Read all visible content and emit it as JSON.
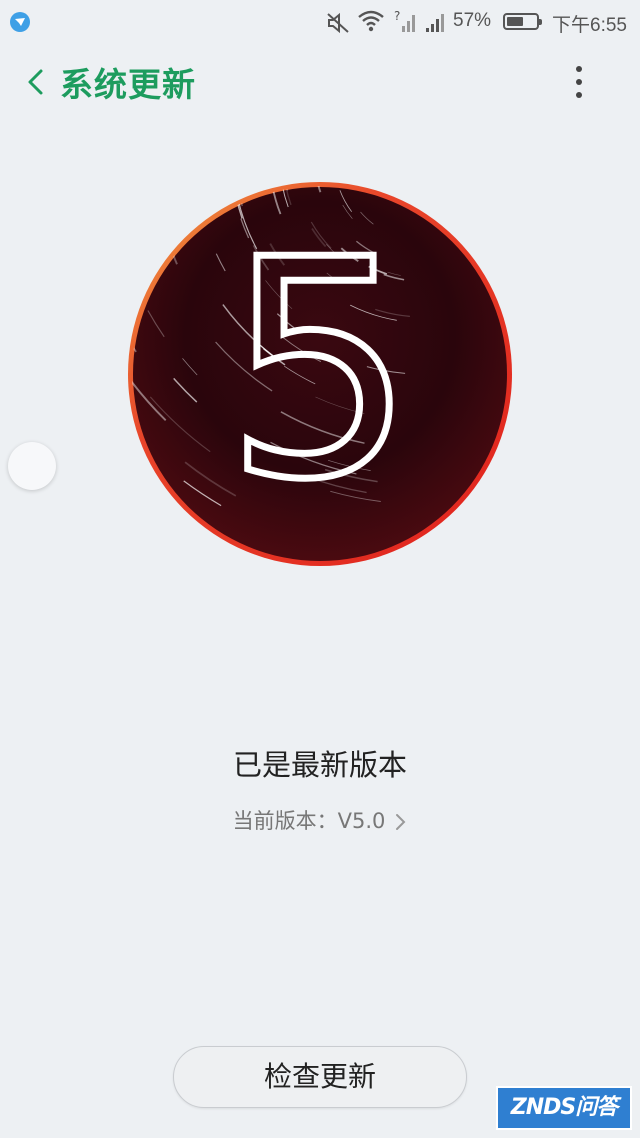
{
  "status_bar": {
    "battery_percent": "57%",
    "battery_level": 0.57,
    "time": "下午6:55",
    "icons": [
      "app-notification-icon",
      "mute-icon",
      "wifi-icon",
      "no-sim-signal-icon",
      "cell-signal-icon",
      "battery-icon"
    ]
  },
  "header": {
    "title": "系统更新",
    "back_icon": "chevron-left-icon",
    "more_icon": "more-vertical-icon"
  },
  "hero": {
    "digit": "5"
  },
  "main": {
    "status": "已是最新版本",
    "version_label": "当前版本：V5.0"
  },
  "actions": {
    "check_update": "检查更新"
  },
  "watermark": {
    "text": "ZNDS问答"
  },
  "colors": {
    "accent": "#1d9c5e",
    "background": "#edf0f3",
    "ring": "#e02a1f"
  }
}
